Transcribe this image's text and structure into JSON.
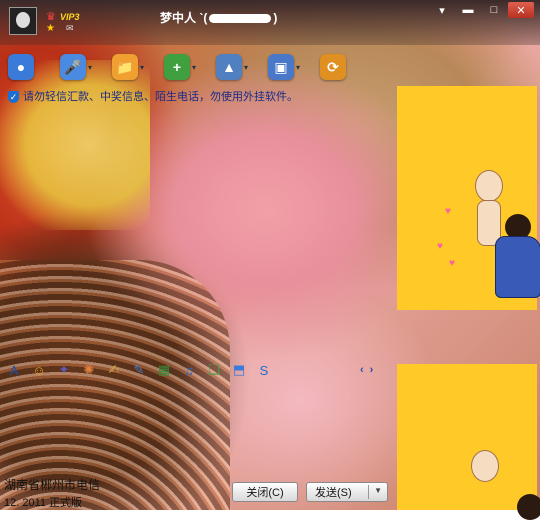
{
  "window": {
    "title_name": "梦中人 `(",
    "title_suffix": ")",
    "vip_level": "VIP3",
    "buttons": {
      "menu": "▾",
      "minimize": "▬",
      "maximize": "□",
      "close": "✕"
    }
  },
  "toolbar": {
    "items": [
      {
        "name": "video-call-icon",
        "glyph": "●",
        "color": "#3a7ad8"
      },
      {
        "name": "voice-call-icon",
        "glyph": "🎤",
        "color": "#4a8ae0"
      },
      {
        "name": "send-file-icon",
        "glyph": "📁",
        "color": "#f0a030"
      },
      {
        "name": "create-group-icon",
        "glyph": "+",
        "color": "#40a040"
      },
      {
        "name": "app-icon",
        "glyph": "▲",
        "color": "#5080c0"
      },
      {
        "name": "remote-assist-icon",
        "glyph": "▣",
        "color": "#4a78c8"
      },
      {
        "name": "share-icon",
        "glyph": "⟳",
        "color": "#e09020"
      }
    ]
  },
  "notice": {
    "text": "请勿轻信汇款、中奖信息、陌生电话，勿使用外挂软件。"
  },
  "emoticons": {
    "items": [
      {
        "name": "font-icon",
        "glyph": "A"
      },
      {
        "name": "smiley-icon",
        "glyph": "☺"
      },
      {
        "name": "magic-face-icon",
        "glyph": "✦"
      },
      {
        "name": "shake-icon",
        "glyph": "✺"
      },
      {
        "name": "voice-message-icon",
        "glyph": "✍"
      },
      {
        "name": "doodle-icon",
        "glyph": "✎"
      },
      {
        "name": "image-icon",
        "glyph": "▦"
      },
      {
        "name": "music-icon",
        "glyph": "♫"
      },
      {
        "name": "gift-icon",
        "glyph": "❏"
      },
      {
        "name": "screenshot-icon",
        "glyph": "⬒"
      },
      {
        "name": "more-icon",
        "glyph": "S"
      }
    ],
    "prev": "‹",
    "next": "›"
  },
  "footer": {
    "signature": "湖南省郴州市电信",
    "version": "12.  2011 正式版",
    "close_label": "关闭(C)",
    "send_label": "发送(S)"
  }
}
